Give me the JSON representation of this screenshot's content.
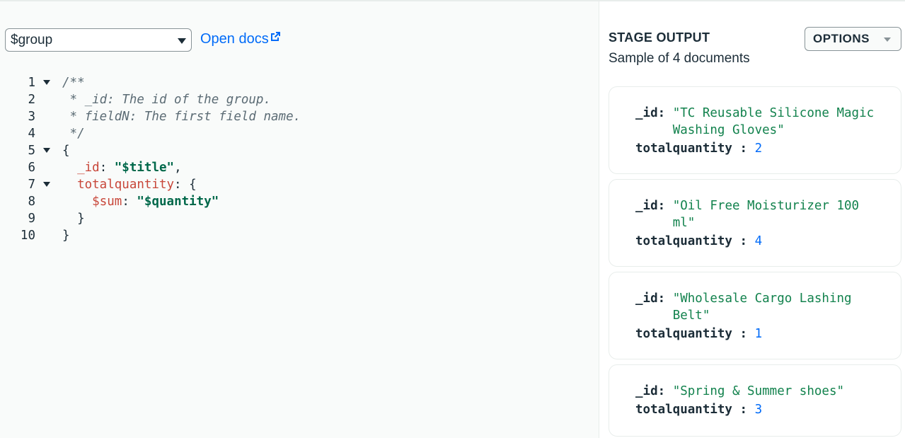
{
  "editor": {
    "stage_operator": "$group",
    "open_docs_label": "Open docs",
    "lines": [
      {
        "n": "1",
        "fold": true,
        "parts": [
          {
            "c": "cmt",
            "t": "/**"
          }
        ]
      },
      {
        "n": "2",
        "fold": false,
        "parts": [
          {
            "c": "cmt",
            "t": " * _id: The id of the group."
          }
        ]
      },
      {
        "n": "3",
        "fold": false,
        "parts": [
          {
            "c": "cmt",
            "t": " * fieldN: The first field name."
          }
        ]
      },
      {
        "n": "4",
        "fold": false,
        "parts": [
          {
            "c": "cmt",
            "t": " */"
          }
        ]
      },
      {
        "n": "5",
        "fold": true,
        "parts": [
          {
            "c": "pun",
            "t": "{"
          }
        ]
      },
      {
        "n": "6",
        "fold": false,
        "parts": [
          {
            "c": "pun",
            "t": "  "
          },
          {
            "c": "key",
            "t": "_id"
          },
          {
            "c": "pun",
            "t": ": "
          },
          {
            "c": "str",
            "t": "\"$title\""
          },
          {
            "c": "pun",
            "t": ","
          }
        ]
      },
      {
        "n": "7",
        "fold": true,
        "parts": [
          {
            "c": "pun",
            "t": "  "
          },
          {
            "c": "key",
            "t": "totalquantity"
          },
          {
            "c": "pun",
            "t": ": {"
          }
        ]
      },
      {
        "n": "8",
        "fold": false,
        "parts": [
          {
            "c": "pun",
            "t": "    "
          },
          {
            "c": "key",
            "t": "$sum"
          },
          {
            "c": "pun",
            "t": ": "
          },
          {
            "c": "str",
            "t": "\"$quantity\""
          }
        ]
      },
      {
        "n": "9",
        "fold": false,
        "parts": [
          {
            "c": "pun",
            "t": "  }"
          }
        ]
      },
      {
        "n": "10",
        "fold": false,
        "parts": [
          {
            "c": "pun",
            "t": "}"
          }
        ]
      }
    ]
  },
  "output": {
    "title": "STAGE OUTPUT",
    "subtitle": "Sample of 4 documents",
    "options_label": "OPTIONS",
    "id_key": "_id:",
    "qty_key": "totalquantity :",
    "documents": [
      {
        "id": "\"TC Reusable Silicone Magic Washing Gloves\"",
        "totalquantity": "2"
      },
      {
        "id": "\"Oil Free Moisturizer 100 ml\"",
        "totalquantity": "4"
      },
      {
        "id": "\"Wholesale Cargo Lashing Belt\"",
        "totalquantity": "1"
      },
      {
        "id": "\"Spring & Summer shoes\"",
        "totalquantity": "3"
      }
    ]
  }
}
